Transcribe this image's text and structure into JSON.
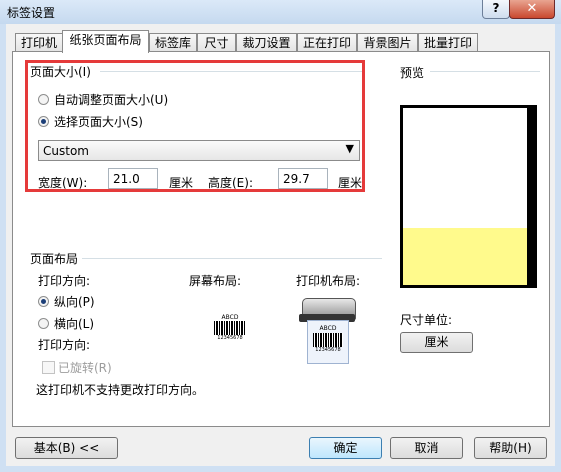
{
  "window": {
    "title": "标签设置",
    "help_label": "?",
    "close_label": "✕"
  },
  "tabs": [
    {
      "label": "打印机"
    },
    {
      "label": "纸张页面布局"
    },
    {
      "label": "标签库"
    },
    {
      "label": "尺寸"
    },
    {
      "label": "裁刀设置"
    },
    {
      "label": "正在打印"
    },
    {
      "label": "背景图片"
    },
    {
      "label": "批量打印"
    }
  ],
  "page_size": {
    "group_label": "页面大小(I)",
    "auto_option": "自动调整页面大小(U)",
    "select_option": "选择页面大小(S)",
    "selected": "select",
    "dropdown_value": "Custom",
    "width_label": "宽度(W):",
    "width_value": "21.0",
    "width_unit": "厘米",
    "height_label": "高度(E):",
    "height_value": "29.7",
    "height_unit": "厘米"
  },
  "preview": {
    "label": "预览",
    "accent_color": "#fffa8c"
  },
  "layout": {
    "group_label": "页面布局",
    "orientation_label": "打印方向:",
    "portrait": "纵向(P)",
    "landscape": "横向(L)",
    "selected": "portrait",
    "orientation_label2": "打印方向:",
    "rotated": "已旋转(R)",
    "screen_layout": "屏幕布局:",
    "printer_layout": "打印机布局:",
    "barcode_text": "ABCD",
    "barcode_number": "12345678",
    "note": "这打印机不支持更改打印方向。"
  },
  "units": {
    "label": "尺寸单位:",
    "button": "厘米"
  },
  "footer": {
    "basic_button": "基本(B) <<",
    "ok_button": "确定",
    "cancel_button": "取消",
    "help_button": "帮助(H)"
  }
}
